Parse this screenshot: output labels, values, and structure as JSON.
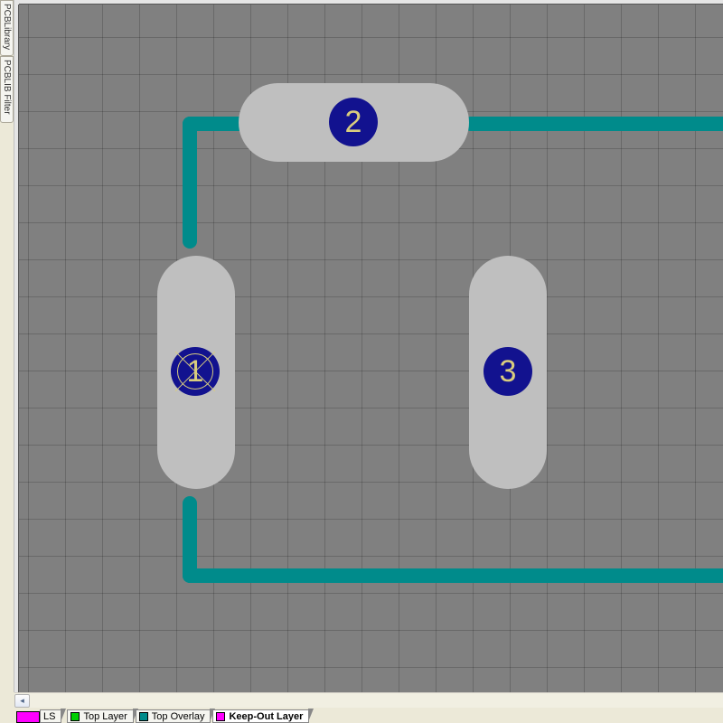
{
  "left_tabs": {
    "tab1": "PCBLibrary",
    "tab2": "PCBLIB Filter"
  },
  "pads": {
    "pin1": "1",
    "pin2": "2",
    "pin3": "3"
  },
  "layers": {
    "ls_label": "LS",
    "top_layer": "Top Layer",
    "top_overlay": "Top Overlay",
    "keepout": "Keep-Out Layer"
  },
  "colors": {
    "ls": "#ff00ff",
    "top_layer": "#00d000",
    "top_overlay": "#008b8b",
    "keepout": "#ff00ff",
    "pad_fill": "#bfbfbf",
    "pin_fill": "#12128f",
    "trace": "#008b8b"
  }
}
